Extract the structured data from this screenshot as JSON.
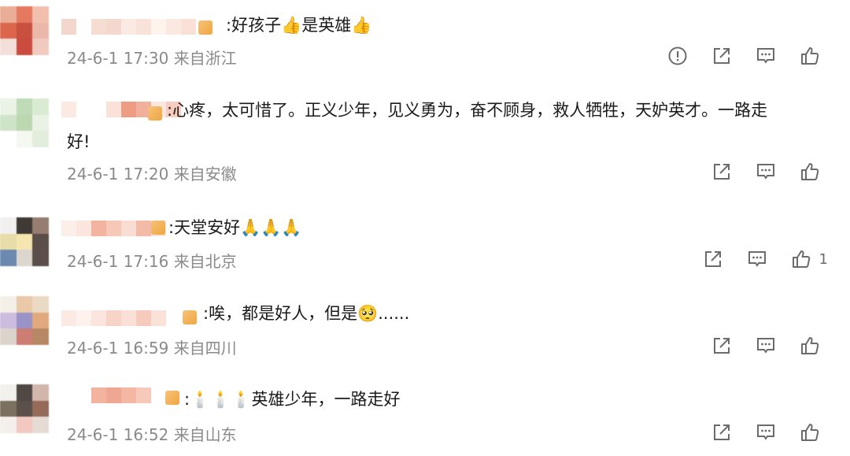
{
  "comments": [
    {
      "text": ":好孩子👍是英雄👍",
      "time": "24-6-1 17:30",
      "location": "来自浙江",
      "has_report": true,
      "like_count": ""
    },
    {
      "text_line1": ":心疼，太可惜了。正义少年，见义勇为，奋不顾身，救人牺牲，天妒英才。一路走",
      "text_line2": "好!",
      "time": "24-6-1 17:20",
      "location": "来自安徽",
      "like_count": ""
    },
    {
      "text": ":天堂安好🙏🙏🙏",
      "time": "24-6-1 17:16",
      "location": "来自北京",
      "like_count": "1"
    },
    {
      "text": ":唉，都是好人，但是🥺......",
      "time": "24-6-1 16:59",
      "location": "来自四川",
      "like_count": ""
    },
    {
      "text": ":🕯️🕯️🕯️英雄少年，一路走好",
      "time": "24-6-1 16:52",
      "location": "来自山东",
      "like_count": ""
    }
  ],
  "icons": {
    "report": "report-icon",
    "share": "share-icon",
    "comment": "comment-icon",
    "like": "thumbs-up-icon"
  }
}
